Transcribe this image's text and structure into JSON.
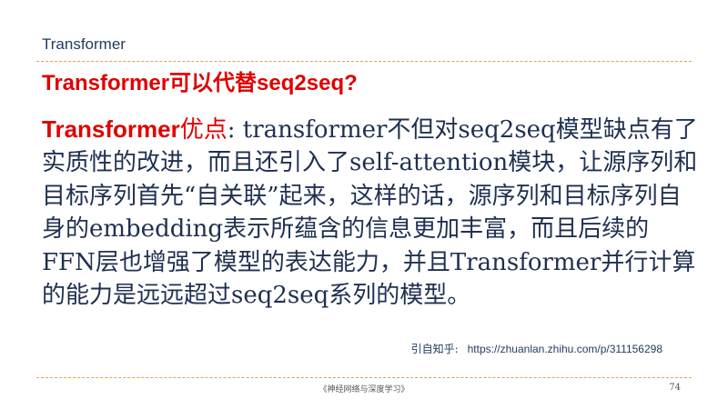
{
  "header": {
    "section": "Transformer",
    "title": "Transformer可以代替seq2seq?"
  },
  "body": {
    "lead": "Transformer",
    "lead_suffix": "优点",
    "text": ": transformer不但对seq2seq模型缺点有了实质性的改进，而且还引入了self-attention模块，让源序列和目标序列首先“自关联”起来，这样的话，源序列和目标序列自身的embedding表示所蕴含的信息更加丰富，而且后续的FFN层也增强了模型的表达能力，并且Transformer并行计算的能力是远远超过seq2seq系列的模型。"
  },
  "citation": {
    "label": "引自知乎:",
    "url": "https://zhuanlan.zhihu.com/p/311156298"
  },
  "footer": {
    "book": "《神经网络与深度学习》",
    "page": "74"
  },
  "colors": {
    "accent_red": "#e00000",
    "text_navy": "#1f3050",
    "rule_orange": "#e8a04a"
  }
}
